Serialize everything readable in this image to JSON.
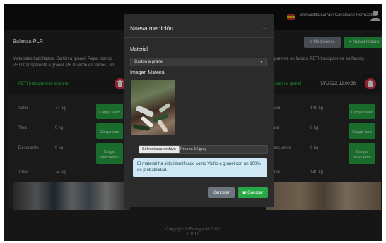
{
  "navbar": {
    "user_name": "Bernardita Larrain Cavalcanti Hormaldo",
    "flag_icon": "flag-icon",
    "avatar_icon": "user-avatar-icon"
  },
  "page": {
    "title": "Balanza-PLR",
    "mediciones_button": "≡ Mediciones",
    "nueva_lectura_button": "+ Nueva lectura",
    "materials_line_1": "Materiales habilitados: Cartón a granel, Papel blanco",
    "materials_line_2": "PETI transparente a granel, PETI verde en fardos, Tet",
    "materials_line_right_1": "sparente en fardos, PETI transparente en fardos,",
    "materials_line_right_2": ""
  },
  "card_left": {
    "material": "PETI transparente a granel",
    "rows": [
      {
        "label": "Valor",
        "value": "74 kg",
        "button": "Cargar valor"
      },
      {
        "label": "Tara",
        "value": "0 kg",
        "button": "Cargar tara"
      },
      {
        "label": "Descuento",
        "value": "0 kg",
        "button": "Cargar descuento"
      },
      {
        "label": "Total",
        "value": "74 kg"
      }
    ]
  },
  "card_right": {
    "material": "Cartón a granel",
    "date": "7/7/2022, 12:00:38",
    "rows": [
      {
        "label": "Valor",
        "value": "140 kg",
        "button": "Cargar valor"
      },
      {
        "label": "Tara",
        "value": "0 kg",
        "button": "Cargar tara"
      },
      {
        "label": "Descuento",
        "value": "0 kg",
        "button": "Cargar descuento"
      },
      {
        "label": "Total",
        "value": "140 kg"
      }
    ]
  },
  "footer": {
    "copyright": "Copyright © EnergyLab 2021",
    "version": "0.0.11"
  },
  "modal": {
    "title": "Nueva medición",
    "close_label": "..",
    "material_label": "Material",
    "material_selected": "Cartón a granel",
    "image_label": "Imagen Material",
    "file_button": "Seleccionar archivo",
    "file_name": "Prueba 16.jpeg",
    "alert_text": "El material ha sido identificado como Vidrio a granel con un 100% de probabilidad.",
    "cancel_button": "Cancelar",
    "save_button": "Guardar",
    "colors": {
      "accent": "#28a745",
      "alert_bg": "#cfe8f3",
      "danger": "#dc3545"
    }
  }
}
